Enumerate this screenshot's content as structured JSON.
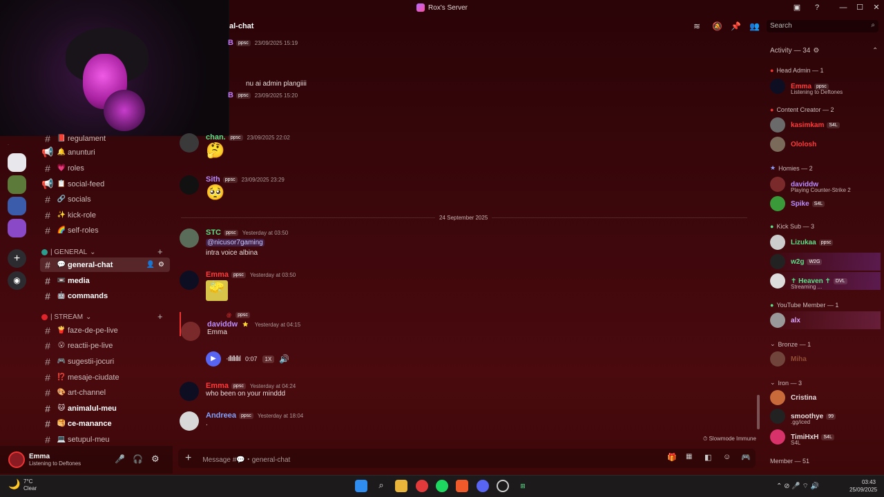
{
  "window": {
    "title": "Rox's Server"
  },
  "channel_header": {
    "name": "al-chat"
  },
  "search": {
    "placeholder": "Search"
  },
  "channels": {
    "items_top": [
      {
        "emoji": "📕",
        "label": "regulament"
      },
      {
        "emoji": "🔔",
        "label": "anunturi"
      },
      {
        "emoji": "💗",
        "label": "roles"
      },
      {
        "emoji": "📋",
        "label": "social-feed"
      },
      {
        "emoji": "🔗",
        "label": "socials"
      },
      {
        "emoji": "✨",
        "label": "kick-role"
      },
      {
        "emoji": "🌈",
        "label": "self-roles"
      }
    ],
    "category_general": "| GENERAL",
    "items_general": [
      {
        "emoji": "💬",
        "label": "general-chat"
      },
      {
        "emoji": "📼",
        "label": "media"
      },
      {
        "emoji": "🤖",
        "label": "commands"
      }
    ],
    "category_stream": "| STREAM",
    "items_stream": [
      {
        "emoji": "🍟",
        "label": "faze-de-pe-live"
      },
      {
        "emoji": "😮",
        "label": "reactii-pe-live"
      },
      {
        "emoji": "🎮",
        "label": "sugestii-jocuri"
      },
      {
        "emoji": "⁉️",
        "label": "mesaje-ciudate"
      },
      {
        "emoji": "🎨",
        "label": "art-channel"
      },
      {
        "emoji": "🐱",
        "label": "animalul-meu"
      },
      {
        "emoji": "🥞",
        "label": "ce-manance"
      },
      {
        "emoji": "💻",
        "label": "setupul-meu"
      }
    ]
  },
  "user_panel": {
    "name": "Emma",
    "status": "Listening to Deftones"
  },
  "messages": [
    {
      "author": "B",
      "tag": "ppsc",
      "time": "23/09/2025 15:19",
      "color": "#c07bff"
    },
    {
      "reply": "nu ai admin plangiiii",
      "author": "B",
      "tag": "ppsc",
      "time": "23/09/2025 15:20",
      "color": "#c07bff"
    },
    {
      "author": "chan.",
      "tag": "ppsc",
      "time": "23/09/2025 22:02",
      "color": "#5ee08a",
      "emoji": "🤔"
    },
    {
      "author": "Sith",
      "tag": "ppsc",
      "time": "23/09/2025 23:29",
      "color": "#b98cff",
      "emoji": "🥺"
    },
    {
      "author": "STC",
      "tag": "ppsc",
      "time": "Yesterday at 03:50",
      "color": "#5ee08a",
      "mention": "@nicusor7gaming",
      "text": "intra voice albina"
    },
    {
      "author": "Emma",
      "tag": "ppsc",
      "time": "Yesterday at 03:50",
      "color": "#ff3b3b",
      "emoji": "🧽"
    },
    {
      "reply_tag": "ppsc",
      "author": "daviddw",
      "time": "Yesterday at 04:15",
      "color": "#b98cff",
      "text": "Emma"
    },
    {
      "author": "Emma",
      "tag": "ppsc",
      "time": "Yesterday at 04:24",
      "color": "#ff3b3b",
      "text": "who been on your minddd"
    },
    {
      "author": "Andreea",
      "tag": "ppsc",
      "time": "Yesterday at 18:04",
      "color": "#7fa0ff",
      "text": "."
    }
  ],
  "date_divider": "24 September 2025",
  "voice": {
    "duration": "0:07",
    "speed": "1X"
  },
  "slowmode": "Slowmode Immune",
  "composer": {
    "placeholder": "Message #💬・general-chat"
  },
  "members": {
    "activity": "Activity — 34",
    "groups": [
      {
        "title": "Head Admin — 1"
      },
      {
        "title": "Content Creator — 2"
      },
      {
        "title": "Homies — 2"
      },
      {
        "title": "Kick Sub — 3"
      },
      {
        "title": "YouTube Member — 1"
      },
      {
        "title": "Bronze — 1"
      },
      {
        "title": "Iron — 3"
      },
      {
        "title": "Member — 51"
      }
    ],
    "list": [
      {
        "name": "Emma",
        "sub": "Listening to Deftones",
        "color": "#ff3b3b",
        "tag": "ppsc"
      },
      {
        "name": "kasimkam",
        "color": "#ff3b3b",
        "tag": "S4L"
      },
      {
        "name": "Ololosh",
        "color": "#ff3b3b"
      },
      {
        "name": "daviddw",
        "sub": "Playing Counter-Strike 2",
        "color": "#b98cff"
      },
      {
        "name": "Spike",
        "color": "#b98cff",
        "tag": "S4L"
      },
      {
        "name": "Lizukaa",
        "color": "#5ee08a",
        "tag": "ppsc"
      },
      {
        "name": "w2g",
        "color": "#5ee08a",
        "tag": "W2G"
      },
      {
        "name": "✝ Heaven ✝",
        "sub": "Streaming ...",
        "color": "#5ee08a",
        "tag": "DVL"
      },
      {
        "name": "alx",
        "color": "#d9a3ff"
      },
      {
        "name": "Miha",
        "color": "#c07a50"
      },
      {
        "name": "Cristina",
        "color": "#e8dede"
      },
      {
        "name": "smoothye",
        "sub": ".gg/iced",
        "color": "#e8dede",
        "tag": "99"
      },
      {
        "name": "TimiHxH",
        "sub": "S4L",
        "color": "#e8dede",
        "tag": "S4L"
      }
    ]
  },
  "taskbar": {
    "weather_temp": "7°C",
    "weather_desc": "Clear",
    "clock_time": "03:43",
    "clock_date": "25/09/2025"
  }
}
